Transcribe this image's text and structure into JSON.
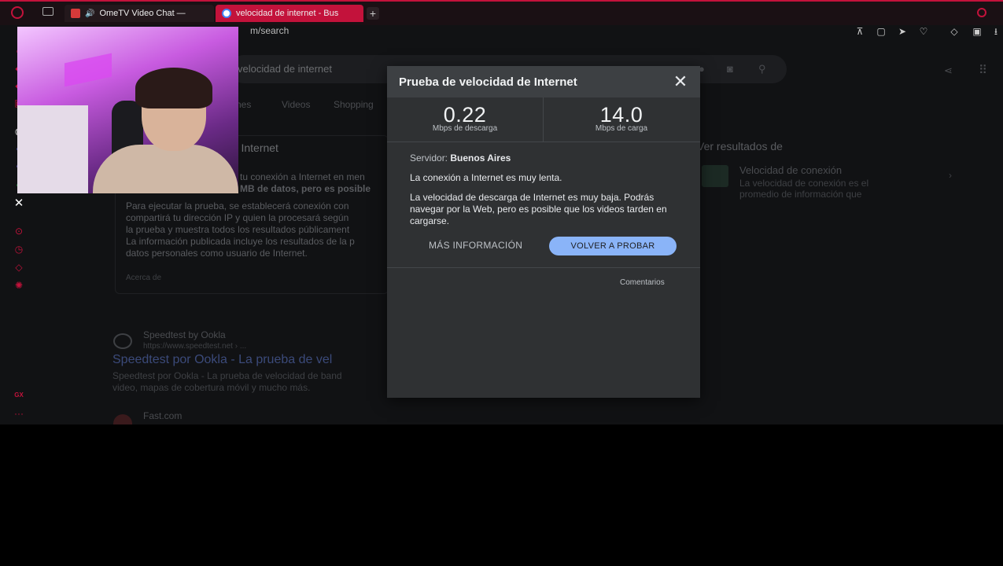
{
  "tabs": [
    {
      "label": "OmeTV Video Chat — ",
      "active": false
    },
    {
      "label": "velocidad de internet - Bus",
      "active": true
    }
  ],
  "address": {
    "url": "m/search"
  },
  "background": {
    "search_query": "velocidad de internet",
    "tab_labels": [
      "nes",
      "Videos",
      "Shopping"
    ],
    "left_card": {
      "heading": "de Internet",
      "lines": [
        "tu conexión a Internet en men",
        "MB de datos, pero es posible"
      ],
      "paragraph": [
        "Para ejecutar la prueba, se establecerá conexión con",
        "compartirá tu dirección IP y quien la procesará según",
        "la prueba y muestra todos los resultados públicament",
        "La información publicada incluye los resultados de la p",
        "datos personales como usuario de Internet."
      ],
      "about": "Acerca de"
    },
    "right_card": {
      "heading": "Ver resultados de",
      "item_title": "Velocidad de conexión",
      "item_desc": [
        "La velocidad de conexión es el",
        "promedio de información que"
      ]
    },
    "results": [
      {
        "site": "Speedtest by Ookla",
        "url": "https://www.speedtest.net › ...",
        "title": "Speedtest por Ookla - La prueba de vel",
        "snippet": [
          "Speedtest por Ookla - La prueba de velocidad de band",
          "video, mapas de cobertura móvil y mucho más."
        ]
      },
      {
        "site": "Fast.com"
      }
    ]
  },
  "dialog": {
    "title": "Prueba de velocidad de Internet",
    "download": {
      "value": "0.22",
      "label": "Mbps de descarga"
    },
    "upload": {
      "value": "14.0",
      "label": "Mbps de carga"
    },
    "server_label": "Servidor:",
    "server_value": "Buenos Aires",
    "message_slow": "La conexión a Internet es muy lenta.",
    "message_detail": "La velocidad de descarga de Internet es muy baja. Podrás navegar por la Web, pero es posible que los videos tarden en cargarse.",
    "more_info": "MÁS INFORMACIÓN",
    "retry": "VOLVER A PROBAR",
    "feedback": "Comentarios"
  },
  "sidebar": {
    "gx_label": "GX",
    "more": "···"
  },
  "colors": {
    "accent": "#c3123b",
    "dialog_bg": "#2f3133",
    "button_blue": "#8ab4f8"
  }
}
